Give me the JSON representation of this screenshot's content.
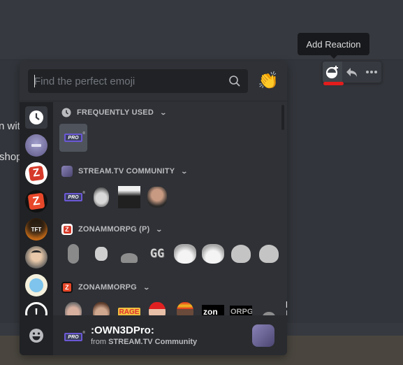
{
  "background": {
    "message_fragments": [
      "n with",
      "shop"
    ]
  },
  "tooltip": {
    "text": "Add Reaction"
  },
  "toolbar": {
    "buttons": [
      {
        "name": "add-reaction",
        "icon": "emoji-add-icon",
        "active": true
      },
      {
        "name": "reply",
        "icon": "reply-icon",
        "active": false
      },
      {
        "name": "more",
        "icon": "more-icon",
        "active": false
      }
    ],
    "highlight_color": "#e31c1c"
  },
  "picker": {
    "search": {
      "placeholder": "Find the perfect emoji",
      "value": ""
    },
    "skin_tone_icon": "clapping-hands-icon",
    "sidebar": [
      {
        "name": "frequently-used",
        "icon": "clock-icon",
        "selected": true
      },
      {
        "name": "stream-tv-community",
        "icon": "server-icon"
      },
      {
        "name": "zonammorpg-p",
        "icon": "server-icon"
      },
      {
        "name": "zonammorpg",
        "icon": "server-icon"
      },
      {
        "name": "tft",
        "icon": "server-icon",
        "label": "TFT"
      },
      {
        "name": "caricature-server",
        "icon": "server-icon"
      },
      {
        "name": "just-want-to-die",
        "icon": "server-icon"
      },
      {
        "name": "exclamation-server",
        "icon": "exclamation-icon"
      },
      {
        "name": "unicode-emoji",
        "icon": "smile-icon"
      }
    ],
    "categories": [
      {
        "title": "FREQUENTLY USED",
        "emojis": [
          "OWN3DPro"
        ]
      },
      {
        "title": "STREAM.TV COMMUNITY",
        "emojis": [
          "OWN3DPro",
          "face-1",
          "priest",
          "face-radio"
        ]
      },
      {
        "title": "ZONAMMORPG (P)",
        "emojis": [
          "zombie",
          "pikachu",
          "parrot",
          "GG",
          "shiba-smug",
          "shiba-wink",
          "thinking-blob",
          "cute-blob"
        ]
      },
      {
        "title": "ZONAMMORPG",
        "emojis": [
          "man-1",
          "man-2",
          "RAGE",
          "santa-man",
          "spain-man",
          "zon",
          "ORPG",
          "parrot",
          "HYPE"
        ]
      }
    ],
    "preview": {
      "name": ":OWN3DPro:",
      "from_prefix": "from",
      "from_server": "STREAM.TV Community"
    },
    "pro_badge_text": "PRO",
    "gg_text": "GG",
    "rage_text": "RAGE",
    "zon_text": "zon",
    "orpg_text": "ORPG",
    "hype_text": "HY PE",
    "tft_text": "TFT"
  }
}
